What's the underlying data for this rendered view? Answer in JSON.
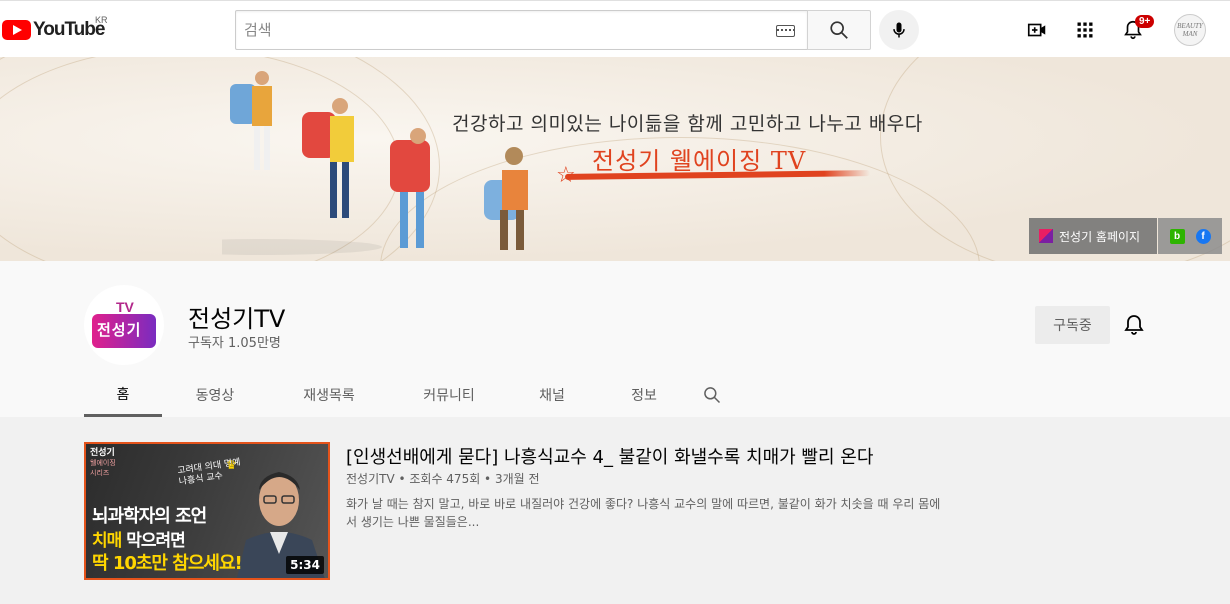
{
  "topbar": {
    "logo_text": "YouTube",
    "region": "KR",
    "search_placeholder": "검색",
    "notification_count": "9+",
    "avatar_text": "BEAUTY MAN"
  },
  "banner": {
    "subtitle": "건강하고 의미있는 나이듦을 함께 고민하고 나누고 배우다",
    "title": "전성기 웰에이징 TV",
    "links": {
      "home_label": "전성기 홈페이지"
    }
  },
  "channel": {
    "name": "전성기TV",
    "subscribers": "구독자 1.05만명",
    "avatar_top": "TV",
    "avatar_text": "전성기",
    "subscribe_label": "구독중"
  },
  "tabs": [
    {
      "label": "홈",
      "active": true
    },
    {
      "label": "동영상"
    },
    {
      "label": "재생목록"
    },
    {
      "label": "커뮤니티"
    },
    {
      "label": "채널"
    },
    {
      "label": "정보"
    }
  ],
  "video": {
    "title": "[인생선배에게 묻다] 나흥식교수 4_ 불같이 화낼수록 치매가 빨리 온다",
    "meta": "전성기TV • 조회수 475회 • 3개월 전",
    "description": "화가 날 때는 참지 말고, 바로 바로 내질러야 건강에 좋다? 나흥식 교수의 말에 따르면, 불같이 화가 치솟을 때 우리 몸에서 생기는 나쁜 물질들은...",
    "duration": "5:34",
    "thumb": {
      "corner_title": "전성기",
      "corner_sub": "웰에이징 시리즈",
      "mid_line1": "고려대 의대 명예",
      "mid_line2": "나흥식 교수",
      "line1": "뇌과학자의 조언",
      "line2_yellow": "치매",
      "line2_rest": " 막으려면",
      "line3": "딱 10초만 참으세요!"
    }
  },
  "colors": {
    "brand_red": "#ff0000",
    "banner_accent": "#e0431f",
    "thumb_border": "#e4531b"
  }
}
